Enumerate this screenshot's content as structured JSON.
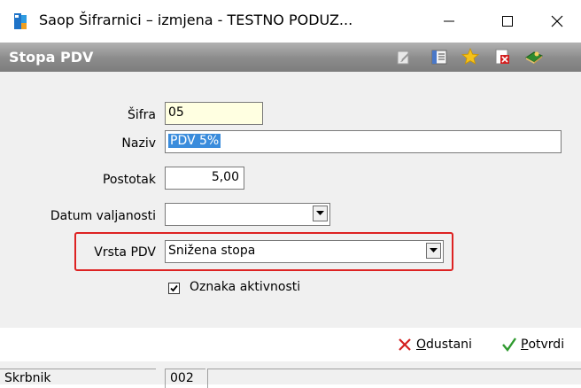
{
  "window": {
    "title": "Saop Šifrarnici – izmjena  - TESTNO PODUZ...",
    "minimize_glyph": "—",
    "maximize_glyph": "☐",
    "close_glyph": "✕"
  },
  "form": {
    "title": "Stopa PDV",
    "fields": {
      "sifra": {
        "label": "Šifra",
        "value": "05"
      },
      "naziv": {
        "label": "Naziv",
        "value": "PDV 5%"
      },
      "postotak": {
        "label": "Postotak",
        "value": "5,00"
      },
      "datum_valjanosti": {
        "label": "Datum valjanosti",
        "value": ""
      },
      "vrsta_pdv": {
        "label": "Vrsta PDV",
        "value": "Snižena stopa"
      }
    },
    "checkbox": {
      "label": "Oznaka aktivnosti",
      "checked": true,
      "mark": "✓"
    }
  },
  "footer": {
    "cancel": {
      "underlined": "O",
      "rest": "dustani"
    },
    "confirm": {
      "underlined": "P",
      "rest": "otvrdi"
    }
  },
  "statusbar": {
    "label": "Skrbnik",
    "value": "002"
  },
  "colors": {
    "header_bar": "#8b8b8b",
    "highlight_border": "#dd2222",
    "selection": "#3a8cdc",
    "sifra_field_bg": "#ffffe1"
  }
}
